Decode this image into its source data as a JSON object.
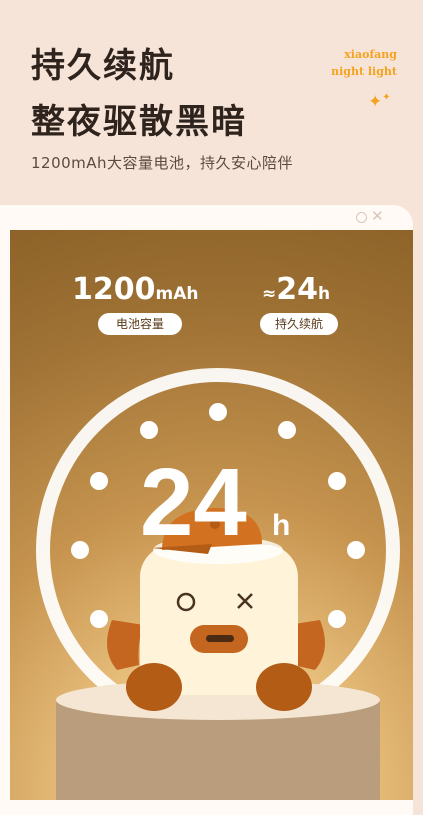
{
  "header": {
    "title_line1": "持久续航",
    "title_line2": "整夜驱散黑暗",
    "subtitle": "1200mAh大容量电池，持久安心陪伴"
  },
  "brand": {
    "line1": "xiaofang",
    "line2": "night light"
  },
  "stats": [
    {
      "value": "1200",
      "unit": "mAh",
      "label": "电池容量"
    },
    {
      "prefix": "≈",
      "value": "24",
      "unit": "h",
      "label": "持久续航"
    }
  ],
  "clock": {
    "value": "24",
    "unit": "h"
  },
  "colors": {
    "accent": "#f5a31f",
    "bg": "#f7e4d8",
    "photo": "#c6944f"
  },
  "icons": [
    "sparkle-icon",
    "circle-icon",
    "close-icon"
  ]
}
